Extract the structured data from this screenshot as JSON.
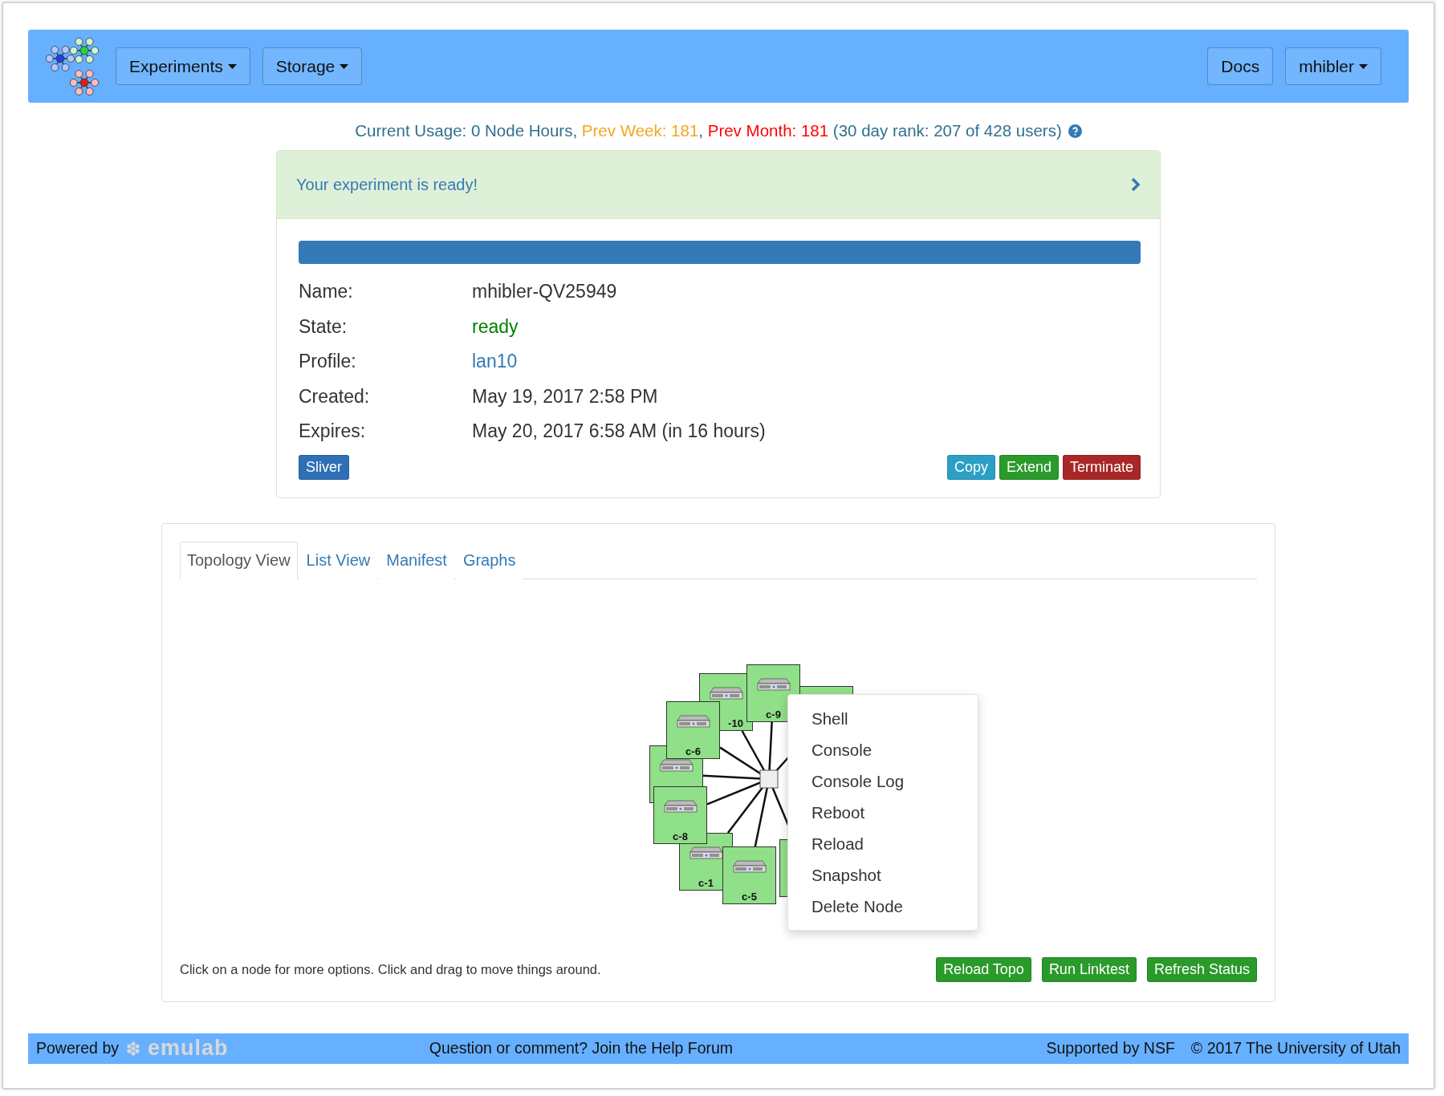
{
  "navbar": {
    "menus": [
      {
        "label": "Experiments",
        "dropdown": true
      },
      {
        "label": "Storage",
        "dropdown": true
      }
    ],
    "right": [
      {
        "label": "Docs",
        "dropdown": false
      },
      {
        "label": "mhibler",
        "dropdown": true
      }
    ]
  },
  "usage": [
    {
      "text": "Current Usage: 0 Node Hours, ",
      "color": "#31708f"
    },
    {
      "text": "Prev Week: 181",
      "color": "#f5a623"
    },
    {
      "text": ",",
      "color": "#31708f"
    },
    {
      "text": " Prev Month: 181",
      "color": "#ff0000"
    },
    {
      "text": " (30 day rank: 207 of 428 users)",
      "color": "#31708f"
    }
  ],
  "status_panel": {
    "heading": "Your experiment is ready!",
    "progress": {
      "level": 1
    },
    "rows": [
      {
        "label": "Name:",
        "value": "mhibler-QV25949",
        "kind": "text"
      },
      {
        "label": "State:",
        "value": "ready",
        "kind": "status"
      },
      {
        "label": "Profile:",
        "value": "lan10",
        "kind": "link"
      },
      {
        "label": "Created:",
        "value": "May 19, 2017 2:58 PM",
        "kind": "text"
      },
      {
        "label": "Expires:",
        "value": "May 20, 2017 6:58 AM (in 16 hours)",
        "kind": "text"
      }
    ],
    "left_buttons": [
      {
        "label": "Sliver",
        "kind": "primary"
      }
    ],
    "right_buttons": [
      {
        "label": "Copy",
        "kind": "info"
      },
      {
        "label": "Extend",
        "kind": "success"
      },
      {
        "label": "Terminate",
        "kind": "danger"
      }
    ]
  },
  "topology_panel": {
    "tabs": [
      {
        "label": "Topology View",
        "selected": true
      },
      {
        "label": "List View",
        "selected": false
      },
      {
        "label": "Manifest",
        "selected": false
      },
      {
        "label": "Graphs",
        "selected": false
      }
    ],
    "nodes": [
      {
        "kind": "covered"
      },
      {
        "kind": "server",
        "label": "-10"
      },
      {
        "kind": "server",
        "label": "c-9"
      },
      {
        "kind": "server"
      },
      {
        "kind": "server",
        "label": "c-6"
      },
      {
        "kind": "server",
        "label": "c-1"
      },
      {
        "kind": "server",
        "label": "c-8"
      },
      {
        "kind": "server",
        "label": "c-5"
      },
      {
        "kind": "covered"
      }
    ],
    "context_menu": [
      "Shell",
      "Console",
      "Console Log",
      "Reboot",
      "Reload",
      "Snapshot",
      "Delete Node"
    ],
    "hint": "Click on a node for more options. Click and drag to move things around.",
    "buttons": [
      "Reload Topo",
      "Run Linktest",
      "Refresh Status"
    ]
  },
  "footer": {
    "powered_by": "Powered by",
    "logo": "emulab",
    "help": "Question or comment? Join the Help Forum",
    "support": "Supported by NSF",
    "copyright": "© 2017 The University of Utah"
  }
}
